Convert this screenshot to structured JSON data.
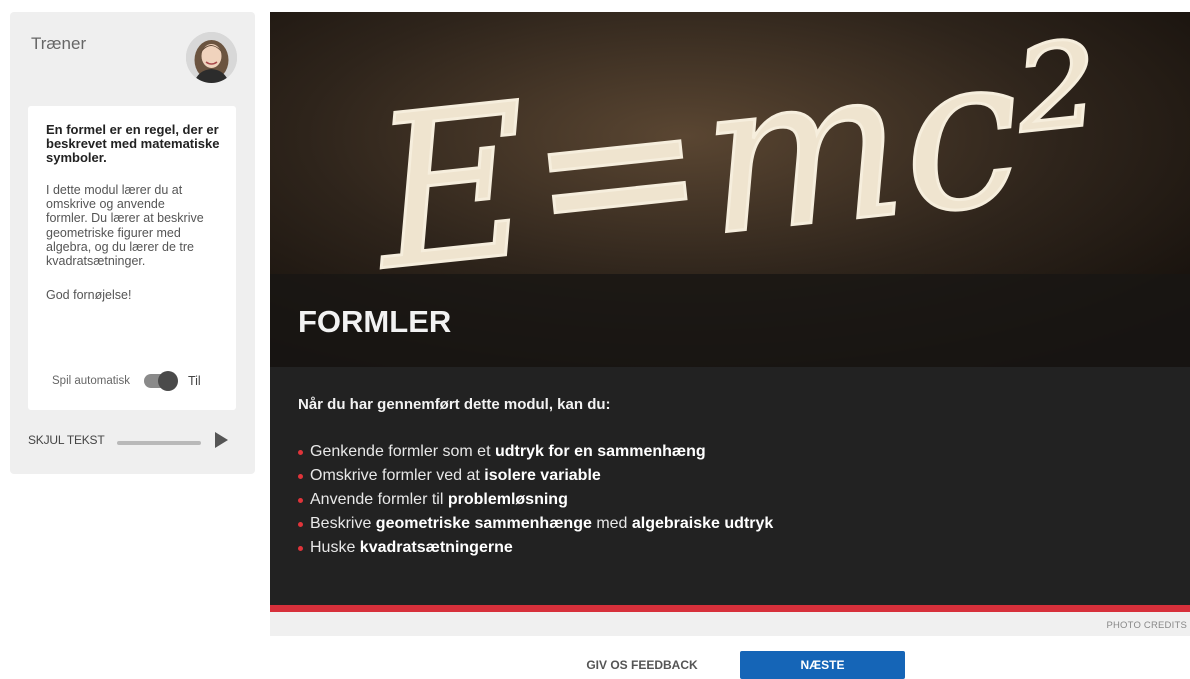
{
  "trainer": {
    "title": "Træner",
    "intro_bold": "En formel er en regel, der er beskrevet med matematiske symboler.",
    "intro_body": "I dette modul lærer du at omskrive og anvende formler. Du lærer at beskrive geometriske figurer med algebra, og du lærer de tre kvadratsætninger.",
    "greeting": "God fornøjelse!",
    "autoplay_label": "Spil automatisk",
    "autoplay_state": "Til",
    "hide_text_label": "SKJUL TEKST",
    "audio_progress": 0
  },
  "hero": {
    "chalk_text": "E=mc²",
    "title": "FORMLER"
  },
  "objectives": {
    "intro": "Når du har gennemført dette modul, kan du:",
    "items": [
      [
        {
          "t": "Genkende formler som et "
        },
        {
          "t": "udtryk for en sammenhæng",
          "b": true
        }
      ],
      [
        {
          "t": "Omskrive formler ved at "
        },
        {
          "t": "isolere variable",
          "b": true
        }
      ],
      [
        {
          "t": "Anvende formler til "
        },
        {
          "t": "problemløsning",
          "b": true
        }
      ],
      [
        {
          "t": "Beskrive "
        },
        {
          "t": "geometriske sammenhænge",
          "b": true
        },
        {
          "t": " med "
        },
        {
          "t": "algebraiske udtryk",
          "b": true
        }
      ],
      [
        {
          "t": "Huske "
        },
        {
          "t": "kvadratsætningerne",
          "b": true
        }
      ]
    ]
  },
  "credits": {
    "label": "PHOTO CREDITS"
  },
  "footer": {
    "feedback_label": "GIV OS FEEDBACK",
    "next_label": "NÆSTE"
  },
  "colors": {
    "accent_red": "#d7303b",
    "next_blue": "#1565b7",
    "bullet_red": "#e0343a"
  }
}
